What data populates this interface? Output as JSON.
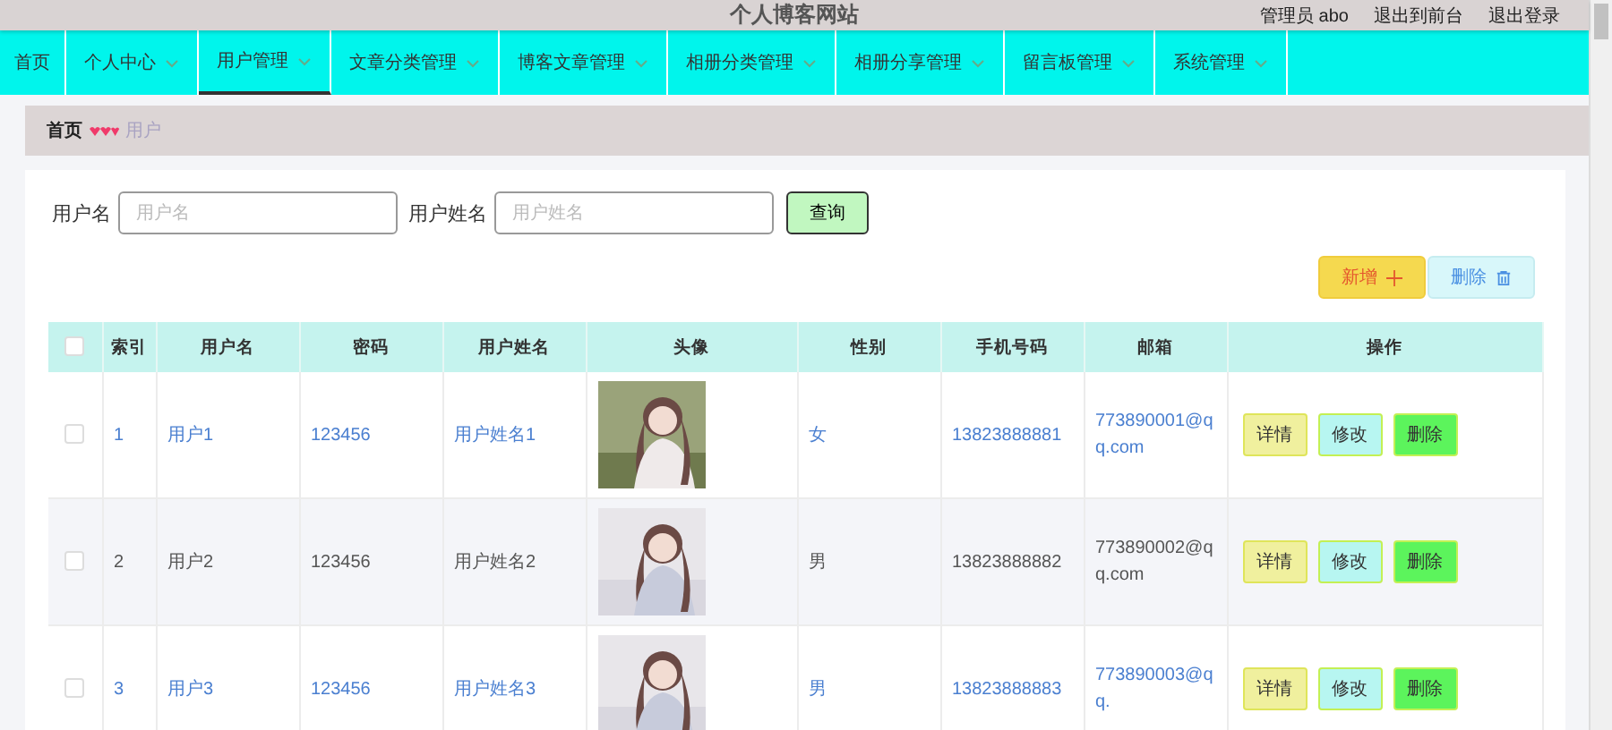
{
  "header": {
    "title": "个人博客网站",
    "links": [
      "管理员 abo",
      "退出到前台",
      "退出登录"
    ]
  },
  "nav": [
    {
      "label": "首页",
      "dropdown": false,
      "selected": false
    },
    {
      "label": "个人中心",
      "dropdown": true,
      "selected": false
    },
    {
      "label": "用户管理",
      "dropdown": true,
      "selected": true
    },
    {
      "label": "文章分类管理",
      "dropdown": true,
      "selected": false
    },
    {
      "label": "博客文章管理",
      "dropdown": true,
      "selected": false
    },
    {
      "label": "相册分类管理",
      "dropdown": true,
      "selected": false
    },
    {
      "label": "相册分享管理",
      "dropdown": true,
      "selected": false
    },
    {
      "label": "留言板管理",
      "dropdown": true,
      "selected": false
    },
    {
      "label": "系统管理",
      "dropdown": true,
      "selected": false
    }
  ],
  "breadcrumb": [
    "首页",
    "用户"
  ],
  "search": [
    {
      "label": "用户名",
      "placeholder": "用户名"
    },
    {
      "label": "用户姓名",
      "placeholder": "用户姓名"
    }
  ],
  "search_button": "查询",
  "toolbar": [
    {
      "kind": "add",
      "label": "新增"
    },
    {
      "kind": "delete",
      "label": "删除"
    }
  ],
  "table": {
    "select_all_checked": false,
    "columns": [
      "索引",
      "用户名",
      "密码",
      "用户姓名",
      "头像",
      "性别",
      "手机号码",
      "邮箱",
      "操作"
    ],
    "rows": [
      {
        "checked": false,
        "highlighted": false,
        "cells": [
          "1",
          "用户1",
          "123456",
          "用户姓名1"
        ],
        "avatar": {
          "kind": "picture"
        },
        "cells2": [
          "女",
          "13823888881",
          "773890001@qq.com"
        ],
        "actions": [
          {
            "kind": "detail",
            "label": "详情"
          },
          {
            "kind": "edit",
            "label": "修改"
          },
          {
            "kind": "remove",
            "label": "删除"
          }
        ]
      },
      {
        "checked": false,
        "highlighted": true,
        "cells": [
          "2",
          "用户2",
          "123456",
          "用户姓名2"
        ],
        "avatar": {
          "kind": "picture"
        },
        "cells2": [
          "男",
          "13823888882",
          "773890002@qq.com"
        ],
        "actions": [
          {
            "kind": "detail",
            "label": "详情"
          },
          {
            "kind": "edit",
            "label": "修改"
          },
          {
            "kind": "remove",
            "label": "删除"
          }
        ]
      },
      {
        "checked": false,
        "highlighted": false,
        "cells": [
          "3",
          "用户3",
          "123456",
          "用户姓名3"
        ],
        "avatar": {
          "kind": "picture"
        },
        "cells2": [
          "男",
          "13823888883",
          "773890003@qq."
        ],
        "actions": [
          {
            "kind": "detail",
            "label": "详情"
          },
          {
            "kind": "edit",
            "label": "修改"
          },
          {
            "kind": "remove",
            "label": "删除"
          }
        ]
      }
    ]
  }
}
